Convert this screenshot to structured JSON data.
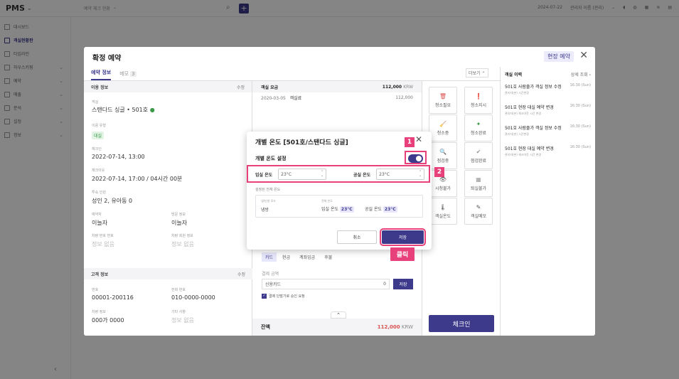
{
  "topbar": {
    "logo": "PMS",
    "property_select": "예약 체크 현황",
    "date": "2024-07-22",
    "user": "관리자 이름 (관리)"
  },
  "sidebar": {
    "items": [
      {
        "label": "대시보드",
        "active": false,
        "expand": false
      },
      {
        "label": "객실현황판",
        "active": true,
        "expand": false
      },
      {
        "label": "타임라인",
        "active": false,
        "expand": false
      },
      {
        "label": "하우스키핑",
        "active": false,
        "expand": true
      },
      {
        "label": "예약",
        "active": false,
        "expand": true
      },
      {
        "label": "매출",
        "active": false,
        "expand": true
      },
      {
        "label": "분석",
        "active": false,
        "expand": true
      },
      {
        "label": "설정",
        "active": false,
        "expand": true
      },
      {
        "label": "정보",
        "active": false,
        "expand": true
      }
    ]
  },
  "modal": {
    "title": "확정 예약",
    "live_btn": "현장 예약",
    "tabs": [
      {
        "label": "예약 정보",
        "active": true
      },
      {
        "label": "메모",
        "count": "3"
      }
    ],
    "more_label": "더보기",
    "guest_section": {
      "title": "이용 정보",
      "edit": "수정",
      "room_label": "객실",
      "room_value": "스탠다드 싱글 • 501호",
      "type_label": "이용 유형",
      "type_value": "대실",
      "checkin_label": "체크인",
      "checkin_value": "2022-07-14, 13:00",
      "checkout_label": "체크아웃",
      "checkout_value": "2022-07-14, 17:00 / 04시간 00분",
      "people_label": "투숙 인원",
      "people_value": "성인 2, 유아동 0",
      "booker_label": "예약자",
      "booker_value": "이늘자",
      "visitor_label": "방문 정보",
      "visitor_value": "이늘자",
      "car_label": "차량 번호 번호",
      "car_value": "정보 없음",
      "car2_label": "차량 회원 정보",
      "car2_value": "정보 없음"
    },
    "customer_section": {
      "title": "고객 정보",
      "edit": "수정",
      "id_label": "번호",
      "id_value": "00001-200116",
      "phone_label": "전화 번호",
      "phone_value": "010-0000-0000",
      "vehicle_label": "차량 정보",
      "vehicle_value": "000가 0000",
      "etc_label": "기타 사항",
      "etc_value": "정보 없음"
    },
    "payment": {
      "title": "객실 요금",
      "total": "112,000",
      "currency": "KRW",
      "row_date": "2020-03-05",
      "row_label": "객실료",
      "row_amount": "112,000",
      "tabs": [
        "카드",
        "현금",
        "계좌입금",
        "후불"
      ],
      "amount_label": "결제 금액",
      "method": "신용카드",
      "zero": "0",
      "apply": "저장",
      "checkbox_label": "결제 단말기로 승인 요청",
      "balance_label": "잔액",
      "balance_value": "112,000",
      "balance_currency": "KRW"
    },
    "actions": [
      {
        "label": "청소필요",
        "icon": "🗑",
        "color": "#d9534f"
      },
      {
        "label": "청소지시",
        "icon": "❗",
        "color": "#d9534f"
      },
      {
        "label": "청소중",
        "icon": "🧹",
        "color": "#d9534f"
      },
      {
        "label": "청소완료",
        "icon": "✦",
        "color": "#3a9a48"
      },
      {
        "label": "점검중",
        "icon": "🔍",
        "color": "#3a9a48"
      },
      {
        "label": "점검완료",
        "icon": "✔",
        "color": "#999"
      },
      {
        "label": "시청불가",
        "icon": "👁",
        "color": "#555"
      },
      {
        "label": "퇴실불가",
        "icon": "▦",
        "color": "#999"
      },
      {
        "label": "객실온도",
        "icon": "🌡",
        "color": "#555"
      },
      {
        "label": "객실메모",
        "icon": "✎",
        "color": "#555"
      }
    ],
    "checkin_btn": "체크인",
    "history": {
      "title": "객실 이력",
      "link": "상세 조회",
      "items": [
        {
          "text": "501호 사람줄가 객실 정보 수정",
          "time": "16:30 (Sun)",
          "sub": "관리자(본) 시간변경"
        },
        {
          "text": "501호 현장 대실 예약 변경",
          "time": "16:30 (Sun)",
          "sub": "관리자(본) 체크아웃 시간 변경"
        },
        {
          "text": "501호 사람줄가 객실 정보 수정",
          "time": "16:30 (Sun)",
          "sub": "관리자(본) 시간변경"
        },
        {
          "text": "501호 현장 대실 예약 변경",
          "time": "16:30 (Sun)",
          "sub": "관리자(본) 체크아웃 시간 변경"
        }
      ]
    }
  },
  "dialog": {
    "title": "개별 온도 [501호/스탠다드 싱글]",
    "setting_label": "개별 온도 설정",
    "in_label": "입실 온도",
    "in_value": "23°C",
    "out_label": "공실 온도",
    "out_value": "23°C",
    "applied_label": "설정된 전체 온도",
    "mode_label": "냉/난방 모드",
    "mode_value": "냉방",
    "all_label": "전체 온도",
    "all_in_label": "입실 온도",
    "all_in_value": "23°C",
    "all_out_label": "공실 온도",
    "all_out_value": "23°C",
    "cancel": "취소",
    "save": "저장"
  },
  "annotations": {
    "num1": "1",
    "num2": "2",
    "click": "클릭"
  },
  "colors": {
    "accent": "#3d3a8c",
    "highlight": "#e8407a"
  }
}
